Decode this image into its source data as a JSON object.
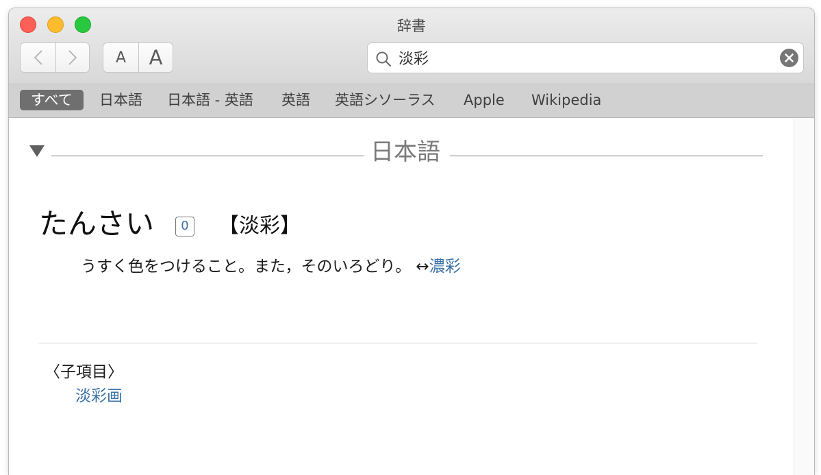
{
  "window": {
    "title": "辞書"
  },
  "toolbar": {
    "small_font_label": "A",
    "large_font_label": "A"
  },
  "search": {
    "value": "淡彩",
    "placeholder": ""
  },
  "scopes": [
    {
      "label": "すべて",
      "active": true
    },
    {
      "label": "日本語",
      "active": false
    },
    {
      "label": "日本語 - 英語",
      "active": false
    },
    {
      "label": "英語",
      "active": false
    },
    {
      "label": "英語シソーラス",
      "active": false
    },
    {
      "label": "Apple",
      "active": false
    },
    {
      "label": "Wikipedia",
      "active": false
    }
  ],
  "entry": {
    "section_title": "日本語",
    "headword": "たんさい",
    "accent": "0",
    "kanji": "【淡彩】",
    "definition": "うすく色をつけること。また，そのいろどり。",
    "antonym_arrow": "↔",
    "antonym": "濃彩",
    "sub_heading": "〈子項目〉",
    "sub_items": [
      "淡彩画"
    ]
  },
  "colors": {
    "link": "#3b73a8",
    "active_scope_bg": "#6f6f6f"
  }
}
